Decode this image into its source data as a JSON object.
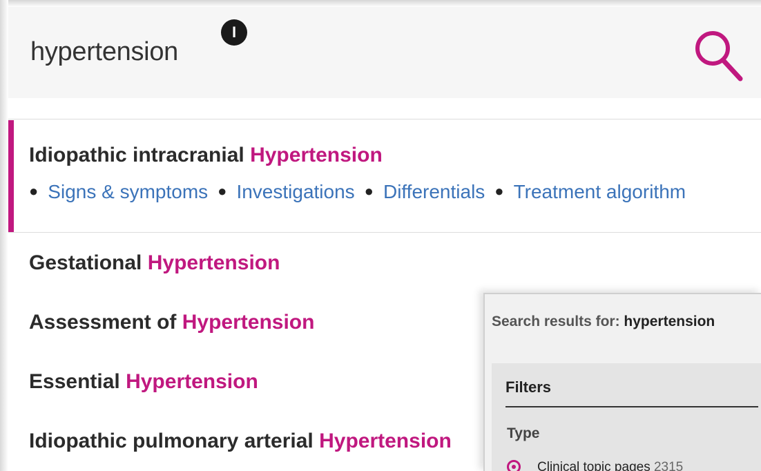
{
  "search": {
    "query": "hypertension",
    "cursor_badge": "I",
    "icon": "search-icon",
    "accent_color": "#c0187f"
  },
  "featured_result": {
    "prefix": "Idiopathic intracranial ",
    "highlight": "Hypertension",
    "links": [
      "Signs & symptoms",
      "Investigations",
      "Differentials",
      "Treatment algorithm"
    ]
  },
  "results": [
    {
      "prefix": "Gestational ",
      "highlight": "Hypertension"
    },
    {
      "prefix": "Assessment of ",
      "highlight": "Hypertension"
    },
    {
      "prefix": "Essential ",
      "highlight": "Hypertension"
    },
    {
      "prefix": "Idiopathic pulmonary arterial ",
      "highlight": "Hypertension"
    }
  ],
  "panel": {
    "header_label": "Search results for: ",
    "header_query": "hypertension",
    "filters_title": "Filters",
    "type_label": "Type",
    "option_label": "Clinical topic pages",
    "option_count": "2315"
  },
  "colors": {
    "highlight": "#c0187f",
    "link": "#3b73b9",
    "search_bg": "#f6f6f6"
  }
}
